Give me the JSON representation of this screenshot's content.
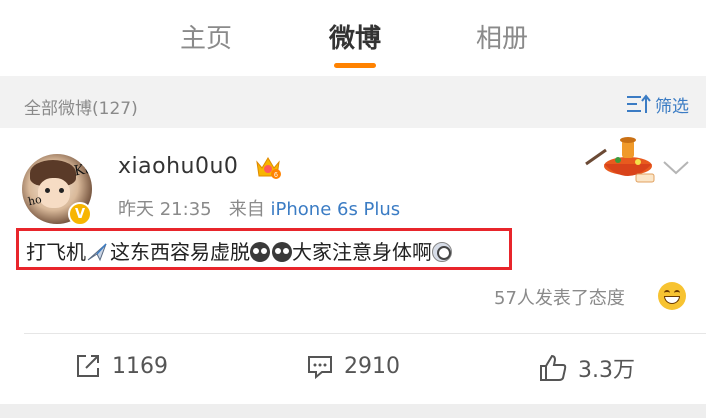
{
  "tabs": [
    {
      "label": "主页",
      "active": false
    },
    {
      "label": "微博",
      "active": true
    },
    {
      "label": "相册",
      "active": false
    }
  ],
  "filter_bar": {
    "all_posts_label": "全部微博(127)",
    "filter_label": "筛选"
  },
  "post": {
    "username": "xiaohu0u0",
    "time": "昨天 21:35",
    "source_prefix": "来自",
    "source": "iPhone 6s Plus",
    "text_parts": [
      "打飞机",
      "这东西容易虚脱",
      "大家注意身体啊"
    ],
    "reactions_text": "57人发表了态度",
    "reposts": "1169",
    "comments": "2910",
    "likes": "3.3万"
  },
  "colors": {
    "accent_orange": "#ff8200",
    "link_blue": "#3b7cc4",
    "highlight_red": "#e8252b"
  }
}
